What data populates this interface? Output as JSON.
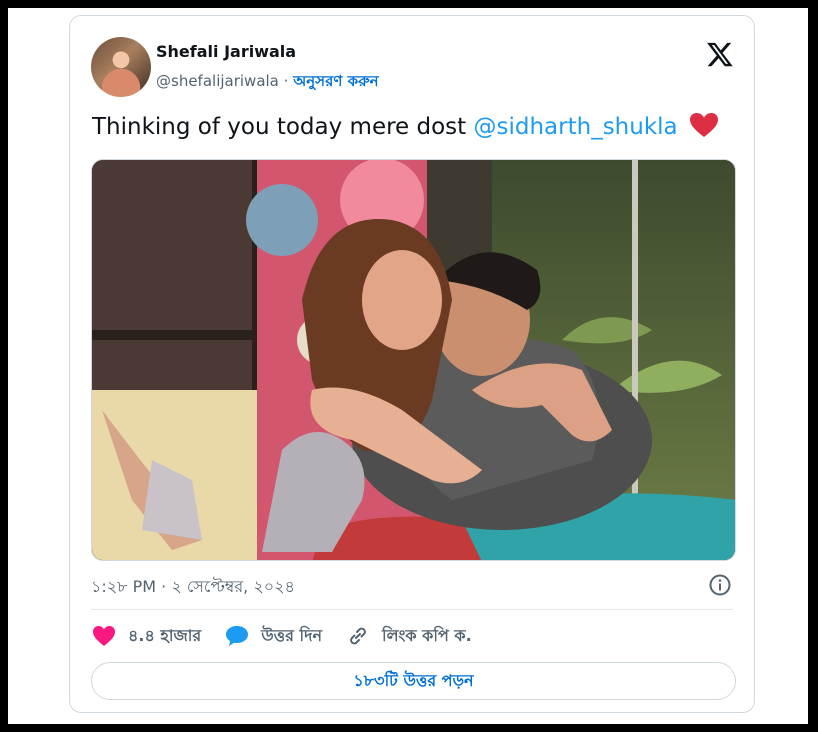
{
  "author": {
    "name": "Shefali Jariwala",
    "handle": "@shefalijariwala",
    "separator": "·",
    "follow_label": "অনুসরণ করুন"
  },
  "tweet": {
    "text_before": "Thinking of you today mere dost ",
    "mention": "@sidharth_shukla"
  },
  "meta": {
    "timestamp": "১:২৮ PM · ২ সেপ্টেম্বর, ২০২৪"
  },
  "actions": {
    "likes": "৪.৪ হাজার",
    "reply": "উত্তর দিন",
    "copy_link": "লিংক কপি ক."
  },
  "read_replies": "১৮৩টি উত্তর পড়ন",
  "colors": {
    "accent": "#1d9bf0",
    "link_dark": "#006fd6",
    "heart": "#f91880",
    "text": "#0f1419",
    "muted": "#536471"
  },
  "icons": {
    "brand": "x-logo-icon",
    "like": "heart-icon",
    "reply": "speech-bubble-icon",
    "copy": "link-icon",
    "info": "info-icon"
  }
}
